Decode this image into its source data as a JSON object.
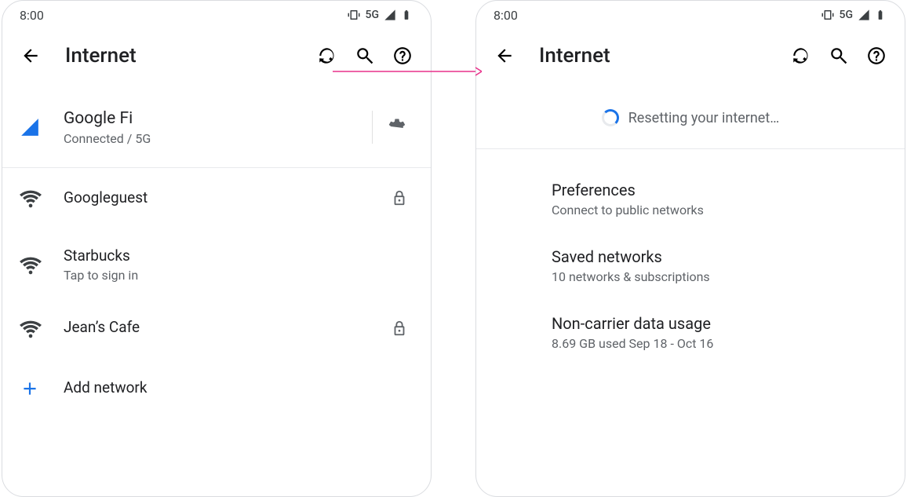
{
  "status": {
    "time": "8:00",
    "network_label": "5G"
  },
  "appbar": {
    "title": "Internet"
  },
  "left": {
    "connected": {
      "name": "Google Fi",
      "status": "Connected / 5G"
    },
    "networks": [
      {
        "name": "Googleguest",
        "subtitle": "",
        "locked": true
      },
      {
        "name": "Starbucks",
        "subtitle": "Tap to sign in",
        "locked": false
      },
      {
        "name": "Jean’s Cafe",
        "subtitle": "",
        "locked": true
      }
    ],
    "add_network": "Add network"
  },
  "right": {
    "progress_text": "Resetting your internet…",
    "settings": [
      {
        "title": "Preferences",
        "subtitle": "Connect to public networks"
      },
      {
        "title": "Saved networks",
        "subtitle": "10 networks & subscriptions"
      },
      {
        "title": "Non-carrier data usage",
        "subtitle": "8.69 GB used Sep 18 - Oct 16"
      }
    ]
  }
}
